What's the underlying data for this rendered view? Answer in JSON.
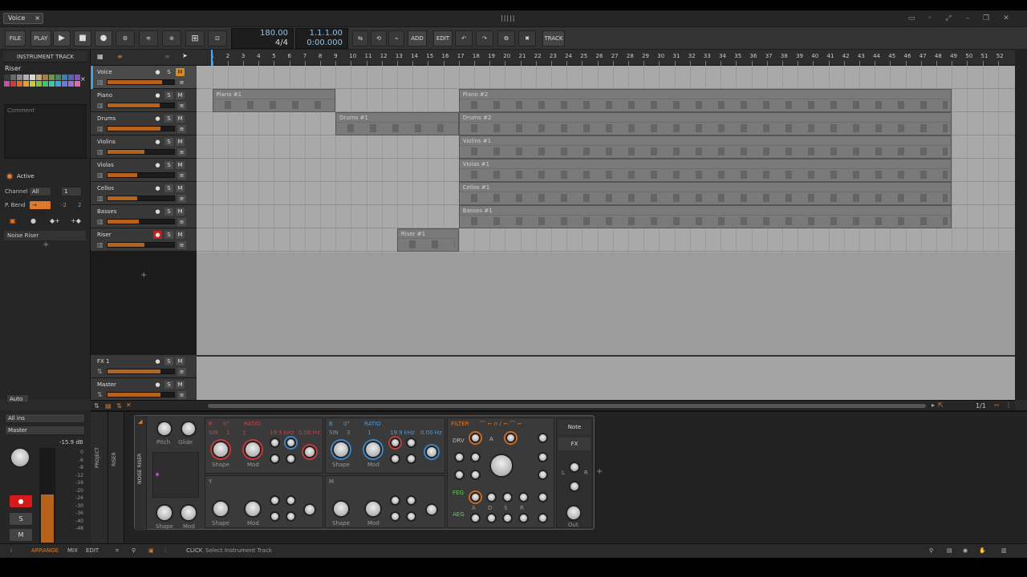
{
  "title_bar": {
    "doc_tab": "Voice",
    "close": "×",
    "logo": "|||||",
    "win_buttons": [
      "▭",
      "◦",
      "⤢",
      "–",
      "❐",
      "✕"
    ]
  },
  "toolbar": {
    "file": "FILE",
    "play_label": "PLAY",
    "tempo": "180.00",
    "meter": "4/4",
    "position": "1.1.1.00",
    "time": "0:00.000",
    "add": "ADD",
    "edit": "EDIT",
    "track": "TRACK"
  },
  "inspector": {
    "header": "INSTRUMENT TRACK",
    "track_name": "Riser",
    "comment_placeholder": "Comment",
    "active_label": "Active",
    "channel_label": "Channel",
    "channel_value": "All",
    "channel_num": "1",
    "pbend_label": "P. Bend",
    "expr_label": "→ Expr",
    "expr_low": "-2",
    "expr_high": "2",
    "device_item": "Noise Riser",
    "palette": [
      "#3a3a3a",
      "#6a6a6a",
      "#8a8a8a",
      "#b0b0b0",
      "#d8d8d8",
      "#c9a86a",
      "#a87c3a",
      "#6c9a3c",
      "#3d8a5e",
      "#3a7fb5",
      "#5a5fc8",
      "#8a4fc0",
      "#c84f9e",
      "#d23a3a",
      "#e06a2a",
      "#e8a22a",
      "#c8c83a",
      "#7ac83a",
      "#3ac86a",
      "#3ac8b0",
      "#3aa8e0",
      "#6a7ae0",
      "#a06ae0",
      "#e06ab0"
    ]
  },
  "tracks": [
    {
      "name": "Voice",
      "level": 0.82,
      "selected": true,
      "mute_on": true,
      "rec_on": false
    },
    {
      "name": "Piano",
      "level": 0.78,
      "selected": false,
      "mute_on": false,
      "rec_on": false
    },
    {
      "name": "Drums",
      "level": 0.8,
      "selected": false,
      "mute_on": false,
      "rec_on": false
    },
    {
      "name": "Violins",
      "level": 0.55,
      "selected": false,
      "mute_on": false,
      "rec_on": false
    },
    {
      "name": "Violas",
      "level": 0.44,
      "selected": false,
      "mute_on": false,
      "rec_on": false
    },
    {
      "name": "Cellos",
      "level": 0.44,
      "selected": false,
      "mute_on": false,
      "rec_on": false
    },
    {
      "name": "Basses",
      "level": 0.47,
      "selected": false,
      "mute_on": false,
      "rec_on": false
    },
    {
      "name": "Riser",
      "level": 0.55,
      "selected": false,
      "mute_on": false,
      "rec_on": true
    }
  ],
  "fx_tracks": [
    {
      "name": "FX 1",
      "level": 0.8
    },
    {
      "name": "Master",
      "level": 0.8
    }
  ],
  "ruler": [
    "1",
    "2",
    "3",
    "4",
    "5",
    "6",
    "7",
    "8",
    "9",
    "10",
    "11",
    "12",
    "13",
    "14",
    "15",
    "16",
    "17",
    "18",
    "19",
    "20",
    "21",
    "22",
    "23",
    "24",
    "25",
    "26",
    "27",
    "28",
    "29",
    "30",
    "31",
    "32",
    "33",
    "34",
    "35",
    "36",
    "37",
    "38",
    "39",
    "40",
    "41",
    "42",
    "43",
    "44",
    "45",
    "46",
    "47",
    "48",
    "49",
    "50",
    "51",
    "52"
  ],
  "clips": [
    {
      "track": 1,
      "label": "Piano #1",
      "start": 1,
      "end": 9
    },
    {
      "track": 1,
      "label": "Piano #2",
      "start": 17,
      "end": 49
    },
    {
      "track": 2,
      "label": "Drums #1",
      "start": 9,
      "end": 17
    },
    {
      "track": 2,
      "label": "Drums #2",
      "start": 17,
      "end": 49
    },
    {
      "track": 3,
      "label": "Violins #1",
      "start": 17,
      "end": 49
    },
    {
      "track": 4,
      "label": "Violas #1",
      "start": 17,
      "end": 49
    },
    {
      "track": 5,
      "label": "Cellos #1",
      "start": 17,
      "end": 49
    },
    {
      "track": 6,
      "label": "Basses #1",
      "start": 17,
      "end": 49
    },
    {
      "track": 7,
      "label": "Riser #1",
      "start": 13,
      "end": 17
    }
  ],
  "arrange_bar": {
    "zoom": "1/1"
  },
  "mixer_left": {
    "auto": "Auto",
    "fx": "FX 1",
    "all_ins": "All ins",
    "master": "Master",
    "db": "-15.9 dB",
    "s": "S",
    "m": "M",
    "scale": [
      "0",
      "-6",
      "-8",
      "-12",
      "-16",
      "-20",
      "-24",
      "-30",
      "-36",
      "-40",
      "-48"
    ]
  },
  "device": {
    "project_label": "PROJECT",
    "riser_label": "RISER",
    "name": "NOISE RISER",
    "pitch": "Pitch",
    "glide": "Glide",
    "shape": "Shape",
    "mod": "Mod",
    "osc_r": {
      "title": "R",
      "deg": "0°",
      "ratio": "RATIO",
      "wave": "SIN",
      "r1": "1",
      "r2": "1",
      "freq": "19.9 kHz",
      "hz": "0.00 Hz"
    },
    "osc_b": {
      "title": "B",
      "deg": "0°",
      "ratio": "RATIO",
      "wave": "SIN",
      "r1": "3",
      "r2": "1",
      "freq": "19.9 kHz",
      "hz": "0.00 Hz"
    },
    "y": "Y",
    "m": "M",
    "filter": "FILTER",
    "drv": "DRV",
    "a_label": "A",
    "feg": "FEG",
    "aeg": "AEG",
    "adsr": [
      "A",
      "D",
      "S",
      "R"
    ],
    "note": "Note",
    "fx": "FX",
    "out": "Out",
    "l": "L",
    "r": "R"
  },
  "status": {
    "arrange": "ARRANGE",
    "mix": "MIX",
    "edit": "EDIT",
    "click": "CLICK",
    "hint": "Select Instrument Track"
  }
}
